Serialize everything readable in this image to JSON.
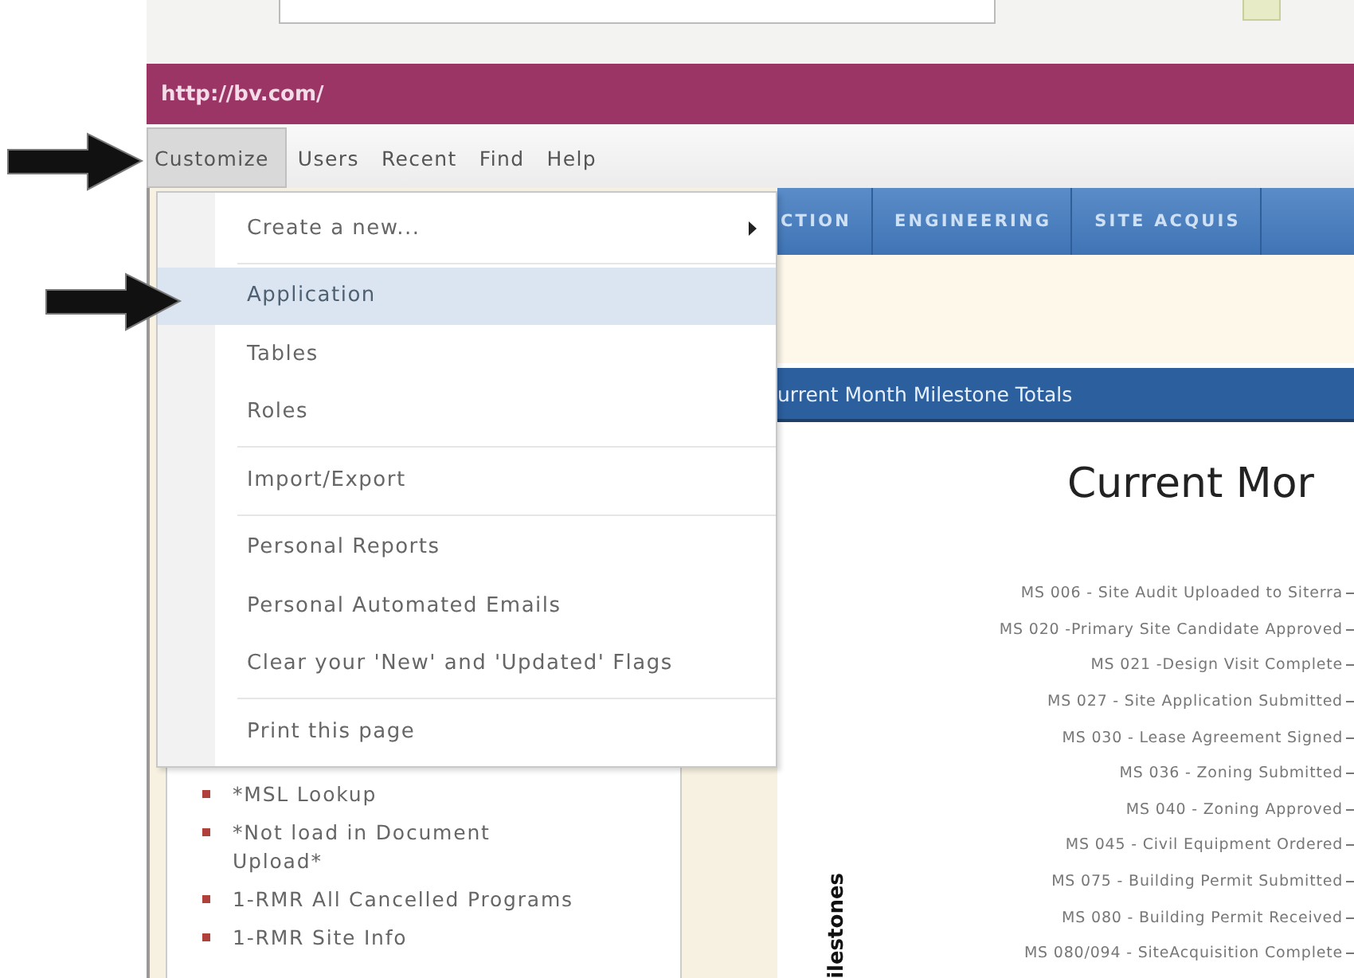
{
  "site_banner": {
    "title": "http://bv.com/"
  },
  "menu_bar": [
    {
      "label": "Customize",
      "selected": true
    },
    {
      "label": "Users",
      "selected": false
    },
    {
      "label": "Recent",
      "selected": false
    },
    {
      "label": "Find",
      "selected": false
    },
    {
      "label": "Help",
      "selected": false
    }
  ],
  "dropdown": {
    "items": [
      {
        "label": "Create a new...",
        "kind": "submenu",
        "selected": false,
        "separator_after": true
      },
      {
        "label": "Application",
        "kind": "item",
        "selected": true,
        "separator_after": false
      },
      {
        "label": "Tables",
        "kind": "item",
        "selected": false,
        "separator_after": false
      },
      {
        "label": "Roles",
        "kind": "item",
        "selected": false,
        "separator_after": true
      },
      {
        "label": "Import/Export",
        "kind": "item",
        "selected": false,
        "separator_after": true
      },
      {
        "label": "Personal Reports",
        "kind": "item",
        "selected": false,
        "separator_after": false
      },
      {
        "label": "Personal Automated Emails",
        "kind": "item",
        "selected": false,
        "separator_after": false
      },
      {
        "label": "Clear your 'New' and 'Updated' Flags",
        "kind": "item",
        "selected": false,
        "separator_after": true
      },
      {
        "label": "Print this page",
        "kind": "item",
        "selected": false,
        "separator_after": false
      }
    ]
  },
  "tabs": [
    {
      "label": "CTION"
    },
    {
      "label": "ENGINEERING"
    },
    {
      "label": "SITE ACQUIS"
    }
  ],
  "panel_header": "urrent Month Milestone Totals",
  "chart": {
    "title": "Current Mor",
    "axis_label": "ilestones",
    "categories": [
      "MS 006 - Site Audit Uploaded to Siterra",
      "MS 020 -Primary Site Candidate Approved",
      "MS 021 -Design Visit Complete",
      "MS 027 - Site Application Submitted",
      "MS 030 - Lease Agreement Signed",
      "MS 036 - Zoning Submitted",
      "MS 040 - Zoning Approved",
      "MS 045 - Civil Equipment Ordered",
      "MS 075 - Building Permit Submitted",
      "MS 080 - Building Permit Received",
      "MS 080/094 - SiteAcquisition Complete"
    ]
  },
  "sidebar": {
    "links": [
      "*MSL Lookup",
      "*Not load in Document Upload*",
      "1-RMR All Cancelled Programs",
      "1-RMR Site Info"
    ]
  }
}
